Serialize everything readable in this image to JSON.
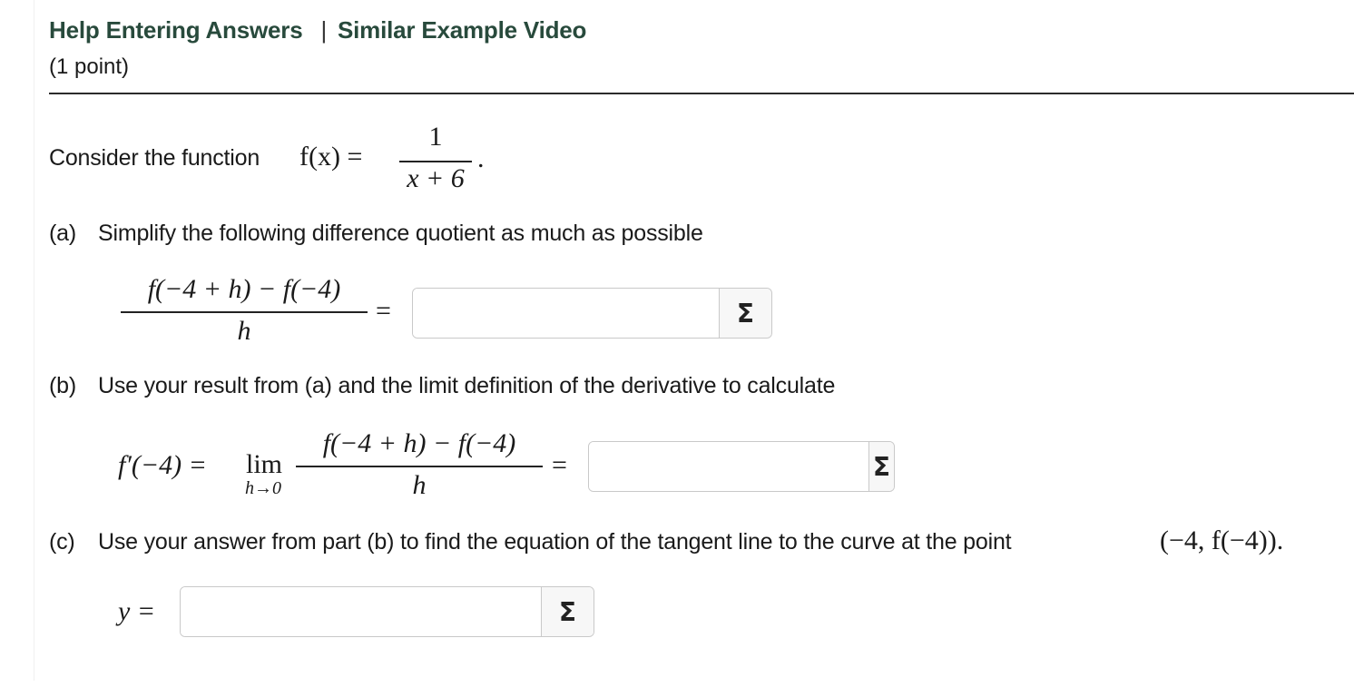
{
  "header": {
    "help_link": "Help Entering Answers",
    "separator": "|",
    "video_link": "Similar Example Video",
    "points": "(1 point)"
  },
  "intro": {
    "text": "Consider the function",
    "function_lhs": "f(x) =",
    "numerator": "1",
    "denominator": "x + 6",
    "period": "."
  },
  "part_a": {
    "label": "(a)",
    "text": "Simplify the following difference quotient as much as possible",
    "numerator": "f(−4 + h) − f(−4)",
    "denominator": "h",
    "equals": "=",
    "answer_value": "",
    "sigma_label": "Σ"
  },
  "part_b": {
    "label": "(b)",
    "text": "Use your result from (a) and the limit definition of the derivative to calculate",
    "lhs": "f′(−4) =",
    "lim": "lim",
    "lim_sub": "h→0",
    "numerator": "f(−4 + h) − f(−4)",
    "denominator": "h",
    "equals": "=",
    "answer_value": "",
    "sigma_label": "Σ"
  },
  "part_c": {
    "label": "(c)",
    "text": "Use your answer from part (b) to find the equation of the tangent line to the curve at the point",
    "point": "(−4, f(−4)).",
    "lhs": "y =",
    "answer_value": "",
    "sigma_label": "Σ"
  }
}
